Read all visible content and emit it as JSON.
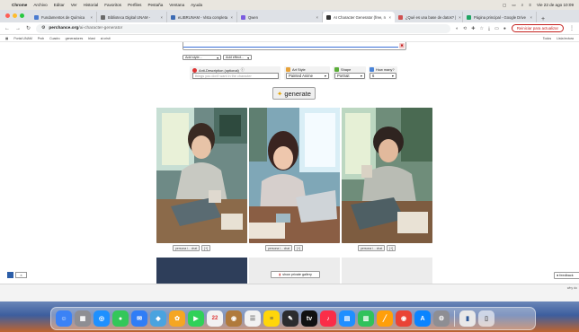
{
  "menubar": {
    "app": "Chrome",
    "items": [
      "Archivo",
      "Editar",
      "Ver",
      "Historial",
      "Favoritos",
      "Perfiles",
      "Pestaña",
      "Ventana",
      "Ayuda"
    ],
    "clock": "Vie 22 de ago  10:09"
  },
  "tabs": [
    {
      "title": "Fundamentos de Química",
      "color": "#4a7bd0"
    },
    {
      "title": "Biblioteca Digital UNAM -",
      "color": "#6a6a6a"
    },
    {
      "title": "eLIBRUNAM - Vista completa",
      "color": "#3c6bb4"
    },
    {
      "title": "Qwen",
      "color": "#7b5ce0"
    },
    {
      "title": "AI Character Generator (free, n",
      "color": "#333333",
      "active": true
    },
    {
      "title": "¿Qué es una base de datos? |",
      "color": "#d05050"
    },
    {
      "title": "Página principal - Google Drive",
      "color": "#1fa463"
    }
  ],
  "address": {
    "host": "perchance.org",
    "path": "/ai-character-generator",
    "reload_label": "Reiniciar para actualizar"
  },
  "bookmarks": [
    "Portal UNAM",
    "Prob",
    "Cuadro",
    "generadores",
    "blast",
    "ai cristi"
  ],
  "bookmarks_right": [
    "Todos",
    "Lista lectura"
  ],
  "controls": {
    "style_select": "Add style...",
    "effect_select": "Add effect...",
    "anti_label": "Anti-Description (optional)",
    "anti_placeholder": "things you don't want in the character",
    "art_style_label": "Art Style",
    "art_style_value": "Painted Anime",
    "shape_label": "Shape",
    "shape_value": "Portrait",
    "how_many_label": "How many?",
    "how_many_value": "6",
    "generate_label": "generate"
  },
  "cards": [
    {
      "persona": "persona i...",
      "chat": "chat",
      "save": "[+]"
    },
    {
      "persona": "persona i...",
      "chat": "chat",
      "save": "[+]"
    },
    {
      "persona": "persona i...",
      "chat": "chat",
      "save": "[+]"
    }
  ],
  "private_gallery": "show private gallery",
  "feedback": "feedback",
  "why_label": "why do"
}
